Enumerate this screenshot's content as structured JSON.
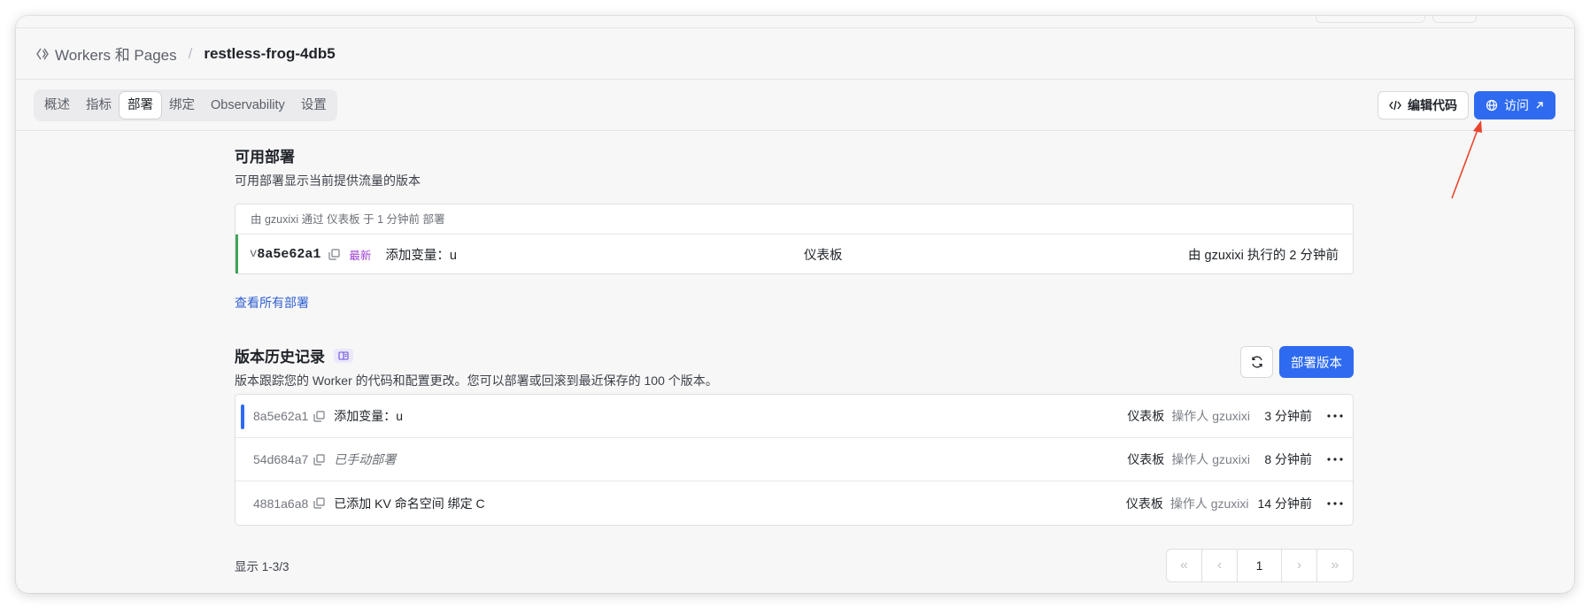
{
  "breadcrumb": {
    "parent": "Workers 和 Pages",
    "current": "restless-frog-4db5"
  },
  "tabs": [
    "概述",
    "指标",
    "部署",
    "绑定",
    "Observability",
    "设置"
  ],
  "active_tab": "部署",
  "header_actions": {
    "edit_code": "编辑代码",
    "visit": "访问"
  },
  "available": {
    "title": "可用部署",
    "subtitle": "可用部署显示当前提供流量的版本",
    "meta": "由 gzuxixi 通过 仪表板 于 1 分钟前 部署",
    "version_prefix": "v",
    "version_id": "8a5e62a1",
    "latest_badge": "最新",
    "message": "添加变量：u",
    "source": "仪表板",
    "by": "由 gzuxixi 执行的 2 分钟前",
    "view_all": "查看所有部署"
  },
  "history": {
    "title": "版本历史记录",
    "subtitle": "版本跟踪您的 Worker 的代码和配置更改。您可以部署或回滚到最近保存的 100 个版本。",
    "deploy_button": "部署版本",
    "rows": [
      {
        "id": "8a5e62a1",
        "message": "添加变量：u",
        "source": "仪表板",
        "operator": "操作人 gzuxixi",
        "time": "3 分钟前"
      },
      {
        "id": "54d684a7",
        "message": "已手动部署",
        "source": "仪表板",
        "operator": "操作人 gzuxixi",
        "time": "8 分钟前"
      },
      {
        "id": "4881a6a8",
        "message": "已添加 KV 命名空间 绑定 C",
        "source": "仪表板",
        "operator": "操作人 gzuxixi",
        "time": "14 分钟前"
      }
    ],
    "showing": "显示 1-3/3",
    "current_page": "1"
  },
  "colors": {
    "primary": "#2f6bf0",
    "latest_accent": "#3fa35a",
    "annotation_arrow": "#e8452c"
  }
}
